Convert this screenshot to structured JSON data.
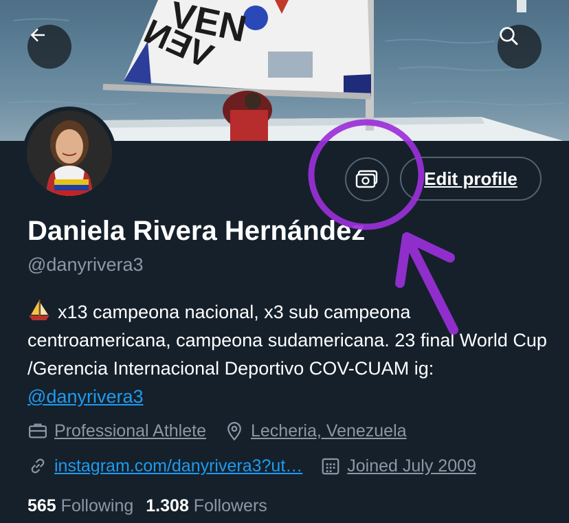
{
  "profile": {
    "name": "Daniela Rivera Hernández",
    "handle": "@danyrivera3",
    "bio_text": "x13 campeona nacional, x3 sub campeona centroamericana, campeona sudamericana. 23 final World Cup /Gerencia Internacional Deportivo COV-CUAM ig: ",
    "bio_mention": "@danyrivera3",
    "category": "Professional Athlete",
    "location": "Lecheria, Venezuela",
    "website": "instagram.com/danyrivera3?ut…",
    "joined": "Joined July 2009",
    "following_count": "565",
    "following_label": "Following",
    "followers_count": "1.308",
    "followers_label": "Followers"
  },
  "actions": {
    "edit_profile_label": "Edit profile"
  },
  "banner": {
    "sail_text_top": "VEN",
    "sail_text_mirrored": "VEN"
  },
  "icons": {
    "back": "arrow-left-icon",
    "search": "search-icon",
    "banner_edit": "image-edit-icon",
    "category": "briefcase-icon",
    "location": "location-pin-icon",
    "website": "link-icon",
    "joined": "calendar-icon",
    "bio_emoji": "sailboat-icon"
  },
  "colors": {
    "background": "#15202b",
    "accent": "#1d9bf0",
    "annotation": "#9b30d9",
    "muted": "#8b98a5"
  }
}
